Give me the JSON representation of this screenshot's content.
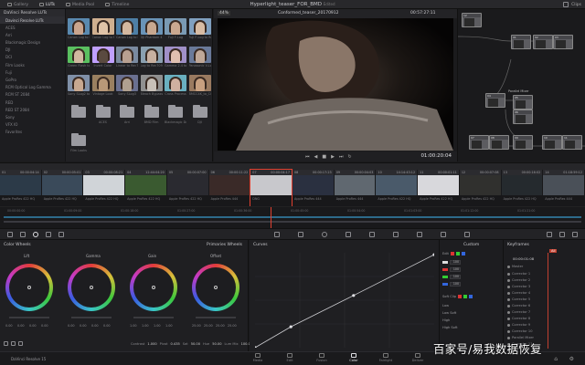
{
  "topbar": {
    "tabs": [
      {
        "label": "Gallery"
      },
      {
        "label": "LUTs"
      },
      {
        "label": "Media Pool"
      },
      {
        "label": "Timeline"
      }
    ],
    "project_title": "Hyperlight_teaser_FOR_BMD",
    "edited": "Edited",
    "clips_label": "Clips"
  },
  "lut_browser": {
    "header": "DaVinci Resolve LUTs",
    "folders": [
      "Davinci Resolve LUTs",
      "ACES",
      "Arri",
      "Blackmagic Design",
      "DJI",
      "DCI",
      "Film Looks",
      "Fuji",
      "GoPro",
      "RCM Optical Log Gamma",
      "RCM ST 2084",
      "RED",
      "RED ST 2084",
      "Sony",
      "VFX IO",
      "Favorites"
    ],
    "luts": [
      "Canon Log to Rec709",
      "Canon Log to Rec709",
      "Canon Log to Rec709",
      "DJI Phantom 4 Log",
      "Fuji F-Log",
      "Fuji F-Log to Rec709",
      "Green Flash to Lower",
      "Invert Color",
      "Linear to Rec709",
      "Log to Rec709",
      "Gamma 2.4 to Rec709",
      "Panasonic V-Log",
      "Sony SLog2 to Rec709",
      "Vintage Look",
      "Sony SLog3",
      "Bleach Bypass",
      "Cross Process",
      "BMCC4K_to_Cinema",
      "",
      "ACES",
      "Arri",
      "BMD Film",
      "Blackmagic Design",
      "DJI",
      "Film Looks"
    ]
  },
  "viewer": {
    "zoom": "44%",
    "clip_name": "Conformed_teaser_20170912",
    "timecode_top": "00:57:27:11",
    "timecode": "01:00:20:04"
  },
  "nodes": {
    "labels": [
      "01",
      "02",
      "03",
      "04",
      "05",
      "06",
      "07",
      "08",
      "09",
      "10",
      "11",
      "12"
    ],
    "parallel_mixer": "Parallel Mixer"
  },
  "timeline": {
    "clips": [
      {
        "num": "01",
        "tc": "00:00:04:14",
        "codec": "Apple ProRes 422 HQ"
      },
      {
        "num": "02",
        "tc": "00:00:05:01",
        "codec": "Apple ProRes 422 HQ"
      },
      {
        "num": "03",
        "tc": "00:00:08:21",
        "codec": "Apple ProRes 422 HQ"
      },
      {
        "num": "04",
        "tc": "12:44:04:20",
        "codec": "Apple ProRes 422 HQ"
      },
      {
        "num": "05",
        "tc": "00:00:07:00",
        "codec": "Apple ProRes 422 HQ"
      },
      {
        "num": "06",
        "tc": "00:00:11:22",
        "codec": "Apple ProRes 444"
      },
      {
        "num": "07",
        "tc": "00:00:04:17",
        "codec": "DNG"
      },
      {
        "num": "08",
        "tc": "00:00:17:23",
        "codec": "Apple ProRes 444"
      },
      {
        "num": "09",
        "tc": "00:00:04:03",
        "codec": "Apple ProRes 444"
      },
      {
        "num": "10",
        "tc": "14:14:43:12",
        "codec": "Apple ProRes 422 HQ"
      },
      {
        "num": "11",
        "tc": "00:00:01:11",
        "codec": "Apple ProRes 422 HQ"
      },
      {
        "num": "12",
        "tc": "00:00:07:08",
        "codec": "Apple ProRes 422 HQ"
      },
      {
        "num": "13",
        "tc": "00:00:16:02",
        "codec": "Apple ProRes 422 HQ"
      },
      {
        "num": "14",
        "tc": "01:18:59:12",
        "codec": "Apple ProRes 444"
      }
    ],
    "ruler_marks": [
      "00:00:00:00",
      "01:00:09:00",
      "01:00:18:00",
      "01:00:27:00",
      "01:00:36:00",
      "01:00:45:00",
      "01:00:54:00",
      "01:01:03:00",
      "01:01:12:00",
      "01:01:21:00"
    ]
  },
  "color_wheels": {
    "title": "Color Wheels",
    "mode": "Primaries Wheels",
    "wheels": [
      {
        "name": "Lift",
        "values": [
          "0.00",
          "0.00",
          "0.00",
          "0.00"
        ]
      },
      {
        "name": "Gamma",
        "values": [
          "0.00",
          "0.00",
          "0.00",
          "0.00"
        ]
      },
      {
        "name": "Gain",
        "values": [
          "1.00",
          "1.00",
          "1.00",
          "1.00"
        ]
      },
      {
        "name": "Offset",
        "values": [
          "25.00",
          "25.00",
          "25.00",
          "25.00"
        ]
      }
    ],
    "footer": {
      "contrast_label": "Contrast",
      "contrast": "1.000",
      "pivot_label": "Pivot",
      "pivot": "0.435",
      "sat_label": "Sat",
      "sat": "50.00",
      "hue_label": "Hue",
      "hue": "50.00",
      "lummix_label": "Lum Mix",
      "lummix": "100.00"
    }
  },
  "curves": {
    "title": "Curves",
    "points": [
      [
        0,
        0
      ],
      [
        0.2,
        0.22
      ],
      [
        0.55,
        0.55
      ],
      [
        1,
        0.98
      ]
    ]
  },
  "custom": {
    "title": "Custom",
    "edit_label": "Edit",
    "rows": [
      "100",
      "100",
      "100",
      "100"
    ],
    "soft_clip": "Soft Clip",
    "low": "Low",
    "low_soft": "Low Soft",
    "high": "High",
    "high_soft": "High Soft"
  },
  "keyframes": {
    "title": "Keyframes",
    "filter": "All",
    "timecode": "00:00:01:08",
    "master": "Master",
    "items": [
      "Corrector 1",
      "Corrector 2",
      "Corrector 3",
      "Corrector 4",
      "Corrector 5",
      "Corrector 6",
      "Corrector 7",
      "Corrector 8",
      "Corrector 9",
      "Corrector 10",
      "Parallel Mixer",
      "Corrector 11"
    ]
  },
  "pagenav": {
    "app": "DaVinci Resolve 15",
    "pages": [
      "Media",
      "Edit",
      "Fusion",
      "Color",
      "Fairlight",
      "Deliver"
    ],
    "active": "Color"
  },
  "watermark": "百家号/易我数据恢复",
  "colors": {
    "accent": "#e0a030",
    "playhead": "#e04030",
    "wheel_lift": "#8a5ad6"
  }
}
